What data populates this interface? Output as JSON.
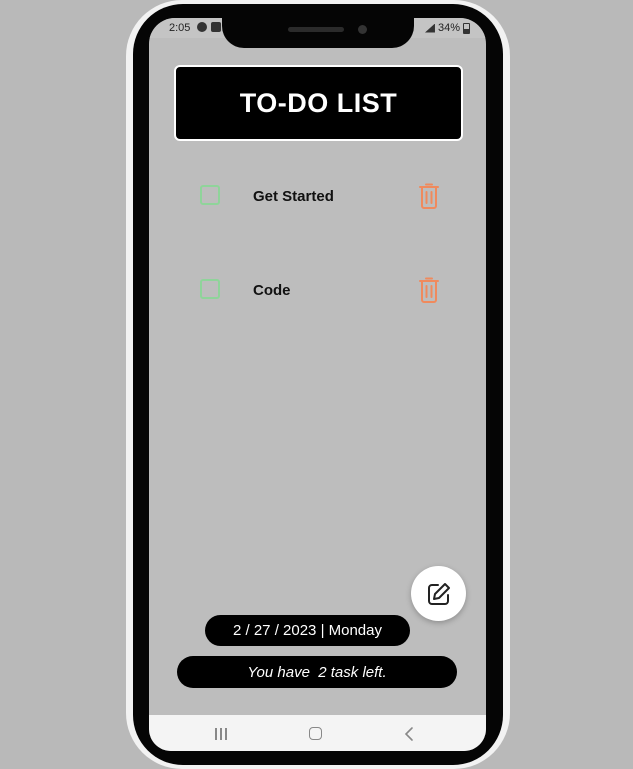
{
  "status_bar": {
    "time": "2:05",
    "battery": "34%"
  },
  "header": {
    "title": "TO-DO LIST"
  },
  "tasks": [
    {
      "label": "Get Started",
      "checked": false
    },
    {
      "label": "Code",
      "checked": false
    }
  ],
  "footer": {
    "date_text": "2 / 27 / 2023 | Monday",
    "tasks_left_text": "You have  2 task left."
  },
  "colors": {
    "screen_bg": "#bdbdbd",
    "checkbox": "#8fd49a",
    "delete_icon": "#f08a5d",
    "pill_bg": "#000000"
  },
  "icons": {
    "fab": "edit-icon",
    "delete": "trash-icon"
  }
}
